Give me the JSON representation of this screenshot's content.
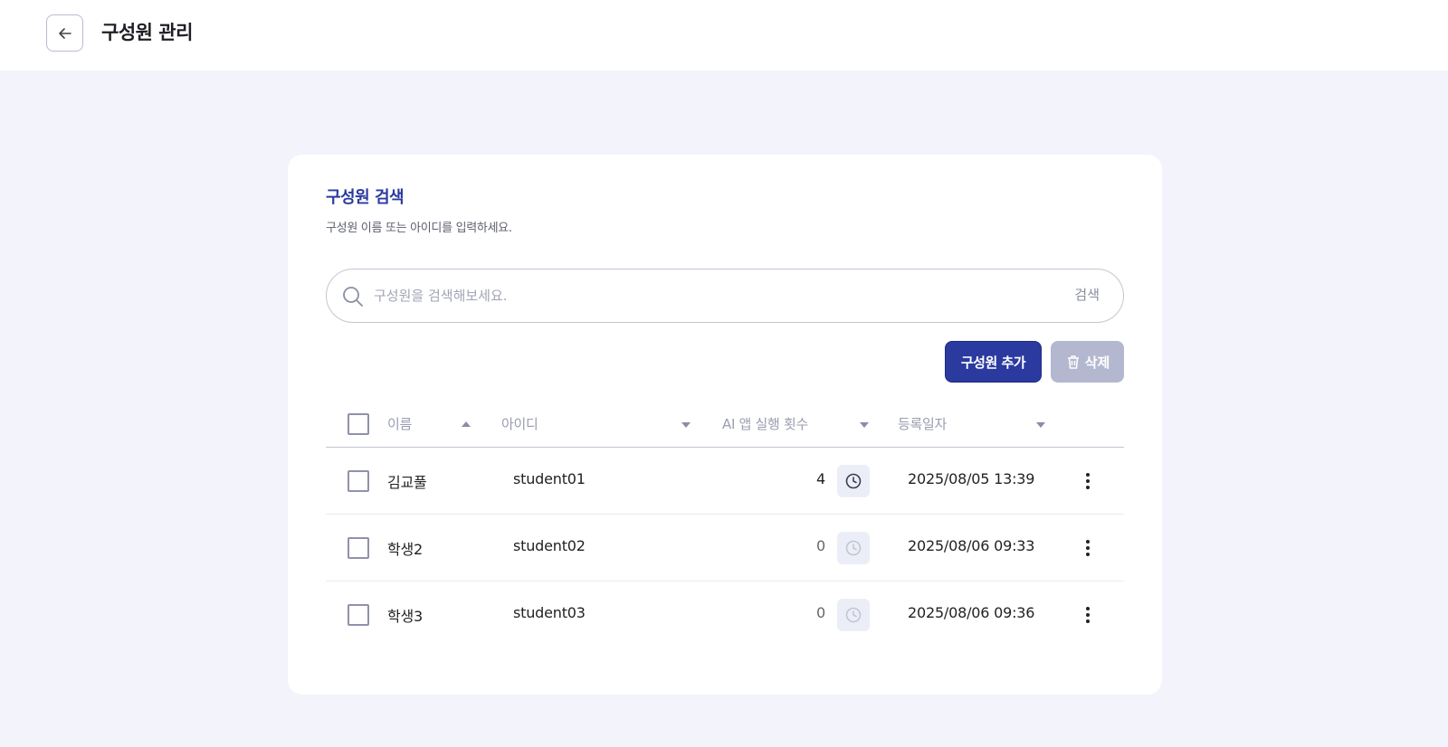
{
  "header": {
    "title": "구성원 관리"
  },
  "search_section": {
    "title": "구성원 검색",
    "description": "구성원 이름 또는 아이디를 입력하세요.",
    "placeholder": "구성원을 검색해보세요.",
    "search_label": "검색"
  },
  "actions": {
    "add_label": "구성원 추가",
    "delete_label": "삭제"
  },
  "table": {
    "columns": {
      "name": "이름",
      "id": "아이디",
      "ai_count": "AI 앱 실행 횟수",
      "registered": "등록일자"
    },
    "rows": [
      {
        "name": "김교풀",
        "id": "student01",
        "ai_count": "4",
        "registered": "2025/08/05 13:39"
      },
      {
        "name": "학생2",
        "id": "student02",
        "ai_count": "0",
        "registered": "2025/08/06 09:33"
      },
      {
        "name": "학생3",
        "id": "student03",
        "ai_count": "0",
        "registered": "2025/08/06 09:36"
      }
    ]
  },
  "colors": {
    "accent": "#2b3a9f",
    "disabled": "#b4b7d0",
    "background": "#f2f3fb"
  },
  "icons": {
    "back": "arrow-left-icon",
    "search": "search-icon",
    "delete": "trash-icon",
    "history": "clock-icon",
    "more": "more-vertical-icon"
  }
}
